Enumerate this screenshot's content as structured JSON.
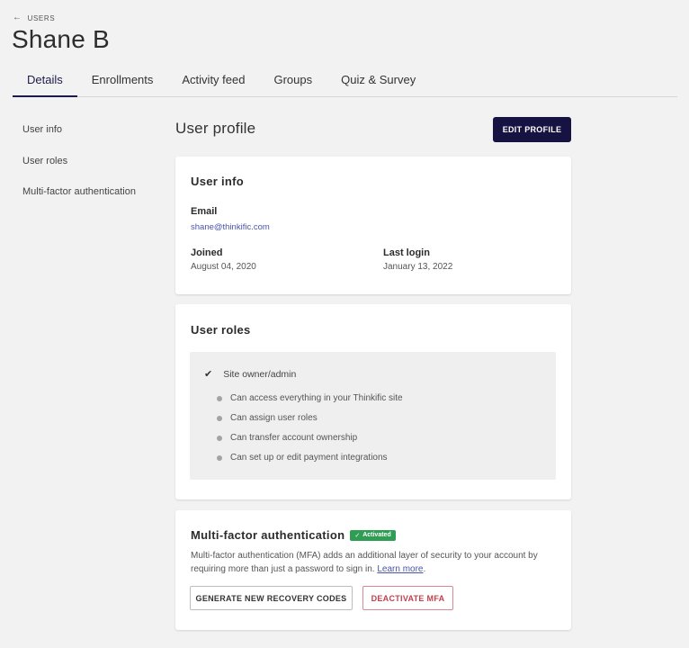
{
  "breadcrumb": {
    "back_label": "USERS"
  },
  "page": {
    "title": "Shane B"
  },
  "tabs": [
    {
      "label": "Details",
      "active": true
    },
    {
      "label": "Enrollments"
    },
    {
      "label": "Activity feed"
    },
    {
      "label": "Groups"
    },
    {
      "label": "Quiz & Survey"
    }
  ],
  "sidenav": [
    "User info",
    "User roles",
    "Multi-factor authentication"
  ],
  "profile": {
    "heading": "User profile",
    "edit_label": "EDIT PROFILE"
  },
  "user_info": {
    "heading": "User info",
    "email_label": "Email",
    "email": "shane@thinkific.com",
    "joined_label": "Joined",
    "joined": "August 04, 2020",
    "last_login_label": "Last login",
    "last_login": "January 13, 2022"
  },
  "user_roles": {
    "heading": "User roles",
    "role": "Site owner/admin",
    "permissions": [
      "Can access everything in your Thinkific site",
      "Can assign user roles",
      "Can transfer account ownership",
      "Can set up or edit payment integrations"
    ]
  },
  "mfa": {
    "heading": "Multi-factor authentication",
    "badge": "Activated",
    "description": "Multi-factor authentication (MFA) adds an additional layer of security to your account by requiring more than just a password to sign in.",
    "learn_more": "Learn more",
    "recovery_label": "GENERATE NEW RECOVERY CODES",
    "deactivate_label": "DEACTIVATE MFA"
  },
  "colors": {
    "primary": "#161342",
    "success": "#2f9e54",
    "danger": "#c0404d",
    "link": "#4a54a8"
  }
}
